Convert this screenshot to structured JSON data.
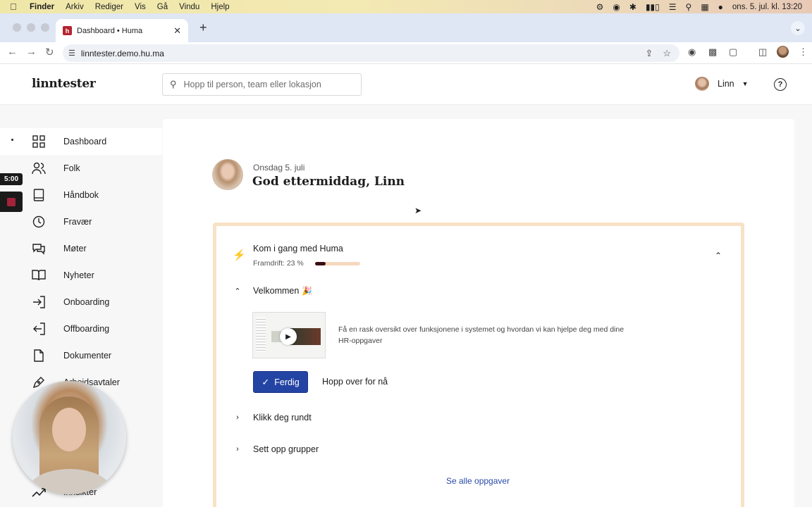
{
  "menubar": {
    "app": "Finder",
    "items": [
      "Arkiv",
      "Rediger",
      "Vis",
      "Gå",
      "Vindu",
      "Hjelp"
    ],
    "clock": "ons. 5. jul. kl. 13:20"
  },
  "browser": {
    "tab_title": "Dashboard • Huma",
    "favicon_letter": "h",
    "url": "linntester.demo.hu.ma"
  },
  "header": {
    "logo": "linntester",
    "search_placeholder": "Hopp til person, team eller lokasjon",
    "user_name": "Linn",
    "help_glyph": "?"
  },
  "sidebar": {
    "items": [
      {
        "label": "Dashboard",
        "icon": "grid-icon"
      },
      {
        "label": "Folk",
        "icon": "people-icon"
      },
      {
        "label": "Håndbok",
        "icon": "book-icon"
      },
      {
        "label": "Fravær",
        "icon": "clock-icon"
      },
      {
        "label": "Møter",
        "icon": "chat-icon"
      },
      {
        "label": "Nyheter",
        "icon": "open-book-icon"
      },
      {
        "label": "Onboarding",
        "icon": "sign-in-icon"
      },
      {
        "label": "Offboarding",
        "icon": "sign-out-icon"
      },
      {
        "label": "Dokumenter",
        "icon": "document-icon"
      },
      {
        "label": "Arbeidsavtaler",
        "icon": "pen-icon"
      },
      {
        "label": "Innsikter",
        "icon": "trend-icon"
      }
    ]
  },
  "recording": {
    "time": "5:00"
  },
  "greeting": {
    "date": "Onsdag 5. juli",
    "title": "God ettermiddag, Linn"
  },
  "onboarding": {
    "title": "Kom i gang med Huma",
    "progress_label": "Framdrift: 23 %",
    "progress_value": 23,
    "sections": [
      {
        "title": "Velkommen",
        "expanded": true
      },
      {
        "title": "Klikk deg rundt",
        "expanded": false
      },
      {
        "title": "Sett opp grupper",
        "expanded": false
      }
    ],
    "welcome_desc": "Få en rask oversikt over funksjonene i systemet og hvordan vi kan hjelpe deg med dine HR-oppgaver",
    "done_button": "Ferdig",
    "skip_button": "Hopp over for nå",
    "see_all": "Se alle oppgaver"
  },
  "colors": {
    "primary": "#2444a4",
    "onboarding_border": "#f8e2c6",
    "progress_fill": "#3b0f14",
    "progress_track": "#f6d8bd",
    "link": "#2a4aa8"
  }
}
